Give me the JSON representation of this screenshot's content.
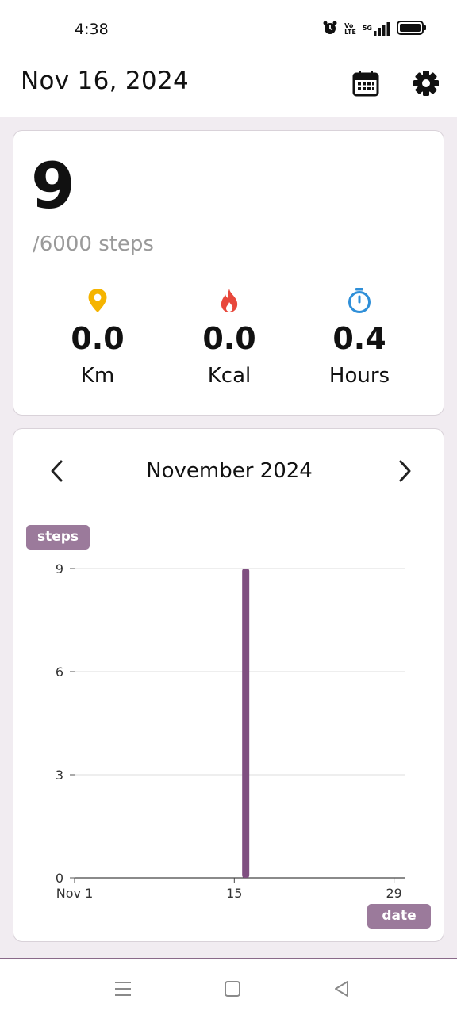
{
  "status_bar": {
    "time": "4:38",
    "volte_top": "Vo",
    "volte_bottom": "LTE",
    "network": "5G",
    "icons": [
      "alarm-icon",
      "volte-icon",
      "signal-icon",
      "battery-icon"
    ]
  },
  "header": {
    "date": "Nov 16, 2024",
    "calendar_icon": "calendar-icon",
    "settings_icon": "gear-icon"
  },
  "summary": {
    "steps": "9",
    "goal": "/6000 steps",
    "metrics": [
      {
        "icon": "location-pin-icon",
        "value": "0.0",
        "unit": "Km",
        "color": "#f5b400"
      },
      {
        "icon": "flame-icon",
        "value": "0.0",
        "unit": "Kcal",
        "color": "#e8483c"
      },
      {
        "icon": "stopwatch-icon",
        "value": "0.4",
        "unit": "Hours",
        "color": "#2f8fd8"
      }
    ]
  },
  "chart_card": {
    "month": "November 2024",
    "prev_icon": "chevron-left-icon",
    "next_icon": "chevron-right-icon",
    "y_badge": "steps",
    "x_badge": "date"
  },
  "chart_data": {
    "type": "bar",
    "x_tick_labels": [
      "Nov 1",
      "15",
      "29"
    ],
    "x_ticks": [
      1,
      15,
      29
    ],
    "y_ticks": [
      0,
      3,
      6,
      9
    ],
    "ylim": [
      0,
      9
    ],
    "xlim": [
      1,
      30
    ],
    "points": [
      {
        "x": 16,
        "y": 9
      }
    ],
    "bar_color": "#7f4f80",
    "grid": true
  },
  "nav_bar": {
    "icons": [
      "menu-icon",
      "home-icon",
      "back-icon"
    ]
  }
}
